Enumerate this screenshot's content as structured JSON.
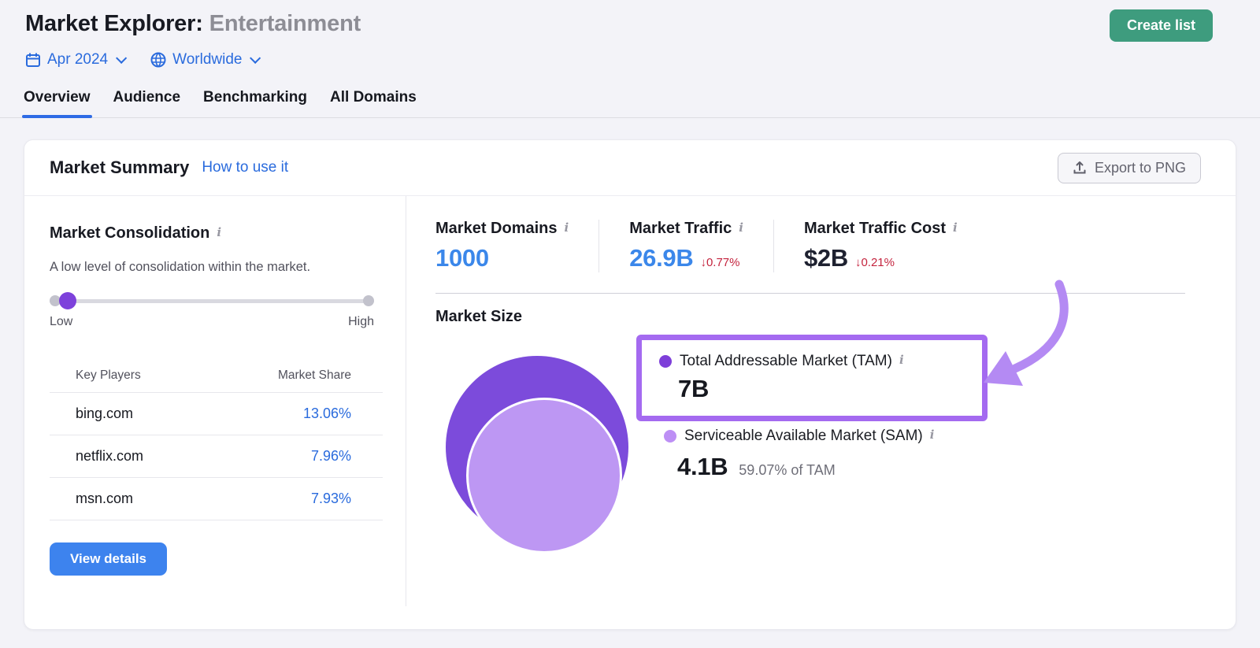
{
  "header": {
    "title_prefix": "Market Explorer:",
    "title_value": "Entertainment",
    "create_list_label": "Create list",
    "date_label": "Apr 2024",
    "region_label": "Worldwide",
    "tabs": [
      {
        "label": "Overview",
        "active": true
      },
      {
        "label": "Audience",
        "active": false
      },
      {
        "label": "Benchmarking",
        "active": false
      },
      {
        "label": "All Domains",
        "active": false
      }
    ]
  },
  "summary": {
    "title": "Market Summary",
    "help_link": "How to use it",
    "export_label": "Export to PNG"
  },
  "consolidation": {
    "title": "Market Consolidation",
    "description": "A low level of consolidation within the market.",
    "slider": {
      "low_label": "Low",
      "high_label": "High",
      "position": "low"
    },
    "table": {
      "headers": [
        "Key Players",
        "Market Share"
      ],
      "rows": [
        {
          "domain": "bing.com",
          "share": "13.06%"
        },
        {
          "domain": "netflix.com",
          "share": "7.96%"
        },
        {
          "domain": "msn.com",
          "share": "7.93%"
        }
      ]
    },
    "view_details_label": "View details"
  },
  "stats": [
    {
      "label": "Market Domains",
      "value": "1000"
    },
    {
      "label": "Market Traffic",
      "value": "26.9B",
      "change": "↓0.77%"
    },
    {
      "label": "Market Traffic Cost",
      "value": "$2B",
      "change": "↓0.21%"
    }
  ],
  "market_size": {
    "title": "Market Size",
    "tam": {
      "label": "Total Addressable Market (TAM)",
      "value": "7B"
    },
    "sam": {
      "label": "Serviceable Available Market (SAM)",
      "value": "4.1B",
      "share_of_tam": "59.07% of TAM"
    }
  },
  "icons": {
    "info": "i"
  },
  "colors": {
    "brand_green": "#3e9c7e",
    "link_blue": "#2a6bdd",
    "value_blue": "#3b87ea",
    "negative_red": "#c4243e",
    "tam_purple": "#7c4bdb",
    "sam_purple": "#bd97f3",
    "highlight_border": "#a46af0",
    "arrow_purple": "#b48af3",
    "slider_handle": "#7d41db"
  }
}
